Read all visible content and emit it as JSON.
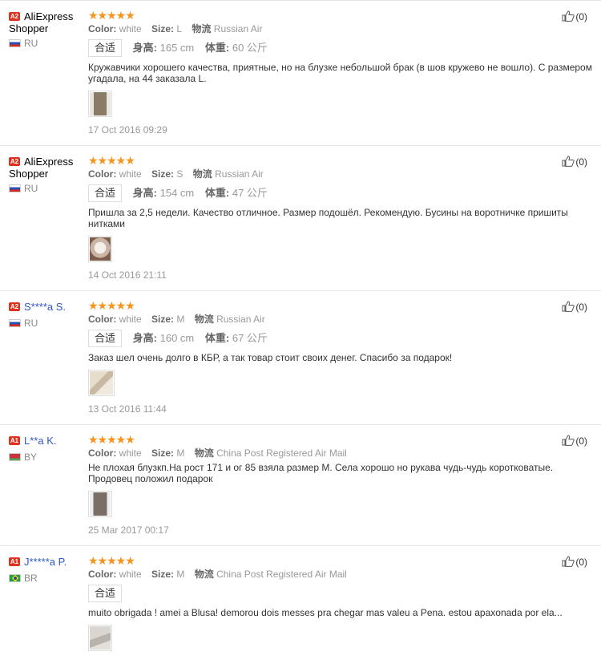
{
  "reviews": [
    {
      "level": "A2",
      "name": "AliExpress Shopper",
      "name_color": "black",
      "country_code": "RU",
      "flag": "ru",
      "stars": "★★★★★",
      "color_label": "Color:",
      "color_value": "white",
      "size_label": "Size:",
      "size_value": "L",
      "shipping_label": "物流",
      "shipping_value": "Russian Air",
      "fit_label": "合适",
      "height_label": "身高:",
      "height_value": "165 cm",
      "weight_label": "体重:",
      "weight_value": "60 公斤",
      "text": "Кружавчики хорошего качества, приятные, но на блузке небольшой брак (в шов кружево не вошло). С размером угадала, на 44 заказала L.",
      "thumb_color": "#8a7a68",
      "date": "17 Oct 2016 09:29",
      "likes": "(0)"
    },
    {
      "level": "A2",
      "name": "AliExpress Shopper",
      "name_color": "black",
      "country_code": "RU",
      "flag": "ru",
      "stars": "★★★★★",
      "color_label": "Color:",
      "color_value": "white",
      "size_label": "Size:",
      "size_value": "S",
      "shipping_label": "物流",
      "shipping_value": "Russian Air",
      "fit_label": "合适",
      "height_label": "身高:",
      "height_value": "154 cm",
      "weight_label": "体重:",
      "weight_value": "47 公斤",
      "text": "Пришла за 2,5 недели. Качество отличное. Размер подошёл. Рекомендую. Бусины на воротничке пришиты нитками",
      "thumb_color": "#c9b4a6",
      "date": "14 Oct 2016 21:11",
      "likes": "(0)"
    },
    {
      "level": "A2",
      "name": "S****a S.",
      "name_color": "blue",
      "country_code": "RU",
      "flag": "ru",
      "stars": "★★★★★",
      "color_label": "Color:",
      "color_value": "white",
      "size_label": "Size:",
      "size_value": "M",
      "shipping_label": "物流",
      "shipping_value": "Russian Air",
      "fit_label": "合适",
      "height_label": "身高:",
      "height_value": "160 cm",
      "weight_label": "体重:",
      "weight_value": "67 公斤",
      "text": "Заказ шел очень долго в КБР, а так товар стоит своих денег. Спасибо за подарок!",
      "thumb_color": "#d8cdbb",
      "date": "13 Oct 2016 11:44",
      "likes": "(0)"
    },
    {
      "level": "A1",
      "name": "L**a K.",
      "name_color": "blue",
      "country_code": "BY",
      "flag": "by",
      "stars": "★★★★★",
      "color_label": "Color:",
      "color_value": "white",
      "size_label": "Size:",
      "size_value": "M",
      "shipping_label": "物流",
      "shipping_value": "China Post Registered Air Mail",
      "fit_label": "",
      "text": "Не плохая блузкп.На рост 171 и ог 85 взяла размер М. Села хорошо но рукава чудь-чудь коротковатые. Продовец положил подарок",
      "thumb_color": "#7a6f66",
      "date": "25 Mar 2017 00:17",
      "likes": "(0)"
    },
    {
      "level": "A1",
      "name": "J*****a P.",
      "name_color": "blue",
      "country_code": "BR",
      "flag": "br",
      "stars": "★★★★★",
      "color_label": "Color:",
      "color_value": "white",
      "size_label": "Size:",
      "size_value": "M",
      "shipping_label": "物流",
      "shipping_value": "China Post Registered Air Mail",
      "fit_label": "合适",
      "text": "muito obrigada ! amei a Blusa! demorou dois messes pra chegar mas valeu a Pena. estou apaxonada por ela...",
      "thumb_color": "#b8b3ad",
      "date": "",
      "likes": "(0)"
    }
  ]
}
